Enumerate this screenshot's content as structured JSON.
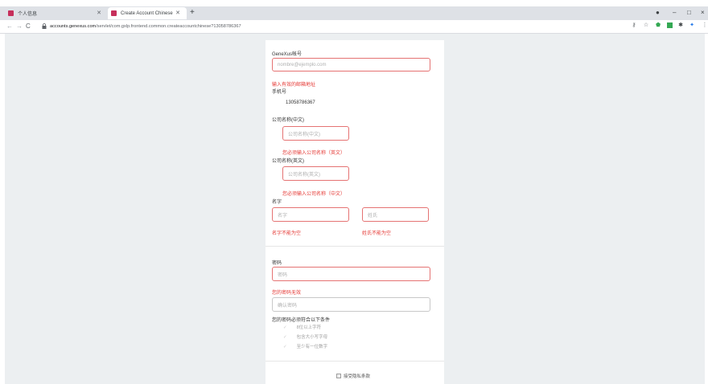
{
  "browser": {
    "tabs": [
      {
        "label": "个人信息",
        "active": false
      },
      {
        "label": "Create Account Chinese",
        "active": true
      }
    ],
    "new_tab": "+",
    "window_buttons": [
      "–",
      "□",
      "×"
    ],
    "url_domain": "accounts.genexus.com",
    "url_path": "/servlet/com.gxlp.frontend.common.createaccountchinese?13058786367",
    "accent": "#c62f5b"
  },
  "form": {
    "email": {
      "label": "GeneXus帐号",
      "placeholder": "nombre@ejemplo.com",
      "error": "输入有效的邮箱地址"
    },
    "phone": {
      "label": "手机号",
      "value": "13058786367"
    },
    "company_cn": {
      "label": "公司名称(中文)",
      "placeholder": "公司名称(中文)",
      "error": "您必须输入公司名称（英文）"
    },
    "company_en": {
      "label": "公司名称(英文)",
      "placeholder": "公司名称(英文)",
      "error": "您必须输入公司名称（中文）"
    },
    "name": {
      "label": "名字",
      "first_placeholder": "名字",
      "last_placeholder": "姓氏",
      "first_error": "名字不能为空",
      "last_error": "姓氏不能为空"
    },
    "password": {
      "label": "密码",
      "placeholder": "密码",
      "error": "您的密码无效",
      "confirm_placeholder": "确认密码"
    },
    "rules": {
      "title": "您的密码必须符合以下条件",
      "items": [
        "8位以上字符",
        "包含大小写字母",
        "至少有一位数字"
      ]
    },
    "agree_label": "接受隐私条款",
    "error_color": "#e53935"
  }
}
